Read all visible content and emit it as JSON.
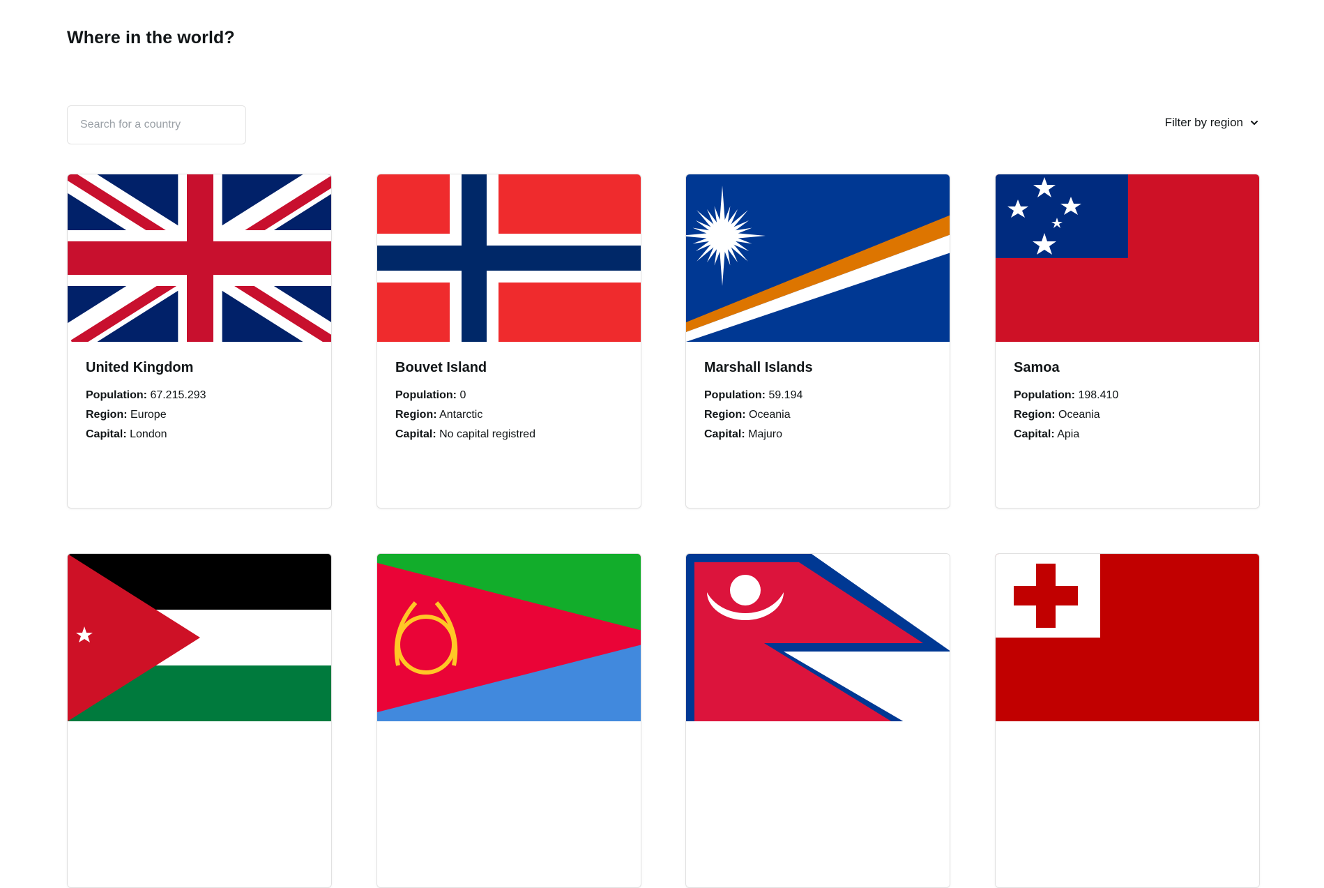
{
  "header": {
    "title": "Where in the world?"
  },
  "search": {
    "placeholder": "Search for a country",
    "value": ""
  },
  "filter": {
    "label": "Filter by region"
  },
  "labels": {
    "population": "Population:",
    "region": "Region:",
    "capital": "Capital:"
  },
  "countries": [
    {
      "name": "United Kingdom",
      "population": "67.215.293",
      "region": "Europe",
      "capital": "London",
      "flag": "uk-flag"
    },
    {
      "name": "Bouvet Island",
      "population": "0",
      "region": "Antarctic",
      "capital": "No capital registred",
      "flag": "bouvet-island-flag"
    },
    {
      "name": "Marshall Islands",
      "population": "59.194",
      "region": "Oceania",
      "capital": "Majuro",
      "flag": "marshall-islands-flag"
    },
    {
      "name": "Samoa",
      "population": "198.410",
      "region": "Oceania",
      "capital": "Apia",
      "flag": "samoa-flag"
    },
    {
      "flag": "jordan-flag"
    },
    {
      "flag": "eritrea-flag"
    },
    {
      "flag": "nepal-flag"
    },
    {
      "flag": "tonga-flag"
    }
  ],
  "colors": {
    "text": "#111517",
    "border": "#e1e1e1",
    "background": "#ffffff"
  }
}
